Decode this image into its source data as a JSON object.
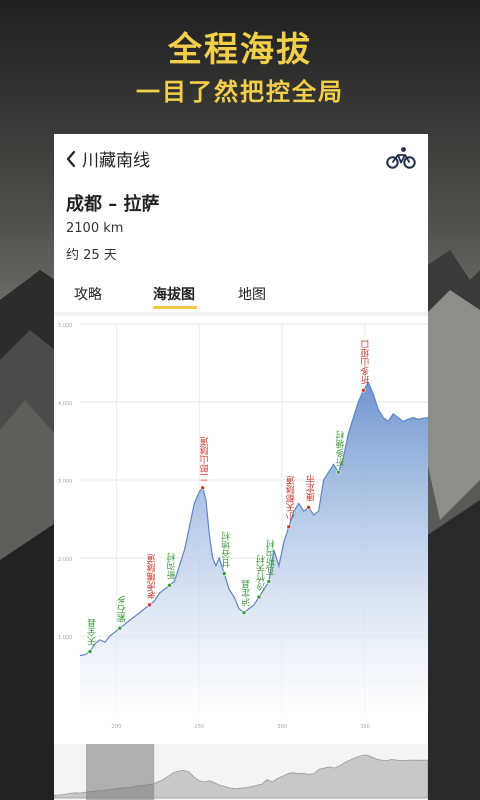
{
  "promo": {
    "title": "全程海拔",
    "subtitle": "一目了然把控全局"
  },
  "header": {
    "back_label": "川藏南线",
    "back_icon": "chevron-left-icon",
    "bike_icon": "bicycle-icon"
  },
  "route": {
    "name": "成都 – 拉萨",
    "distance": "2100 km",
    "duration": "约 25 天"
  },
  "tabs": [
    {
      "label": "攻略",
      "active": false
    },
    {
      "label": "海拔图",
      "active": true
    },
    {
      "label": "地图",
      "active": false
    }
  ],
  "colors": {
    "accent": "#f3c83e",
    "fill_top": "#6f96d1",
    "fill_bottom": "#ffffff",
    "line": "#5d85c4",
    "town_label": "#3c9a3c",
    "pass_label": "#c83a2e"
  },
  "chart_data": {
    "type": "area",
    "xlabel": "",
    "ylabel": "",
    "xlim": [
      178,
      388
    ],
    "ylim": [
      0,
      5000
    ],
    "y_ticks": [
      "1,000",
      "2,000",
      "3,000",
      "4,000",
      "5,000"
    ],
    "y_tick_values": [
      1000,
      2000,
      3000,
      4000,
      5000
    ],
    "x_ticks": [
      "200",
      "250",
      "300",
      "350"
    ],
    "x_tick_values": [
      200,
      250,
      300,
      350
    ],
    "grid": true,
    "series": [
      {
        "x": [
          178,
          181,
          184,
          187,
          190,
          193,
          196,
          199,
          202,
          205,
          208,
          211,
          214,
          217,
          220,
          223,
          226,
          229,
          232,
          235,
          238,
          241,
          244,
          247,
          250,
          252,
          254,
          256,
          258,
          260,
          262,
          265,
          268,
          271,
          274,
          277,
          280,
          283,
          286,
          289,
          292,
          295,
          298,
          301,
          304,
          307,
          310,
          313,
          316,
          319,
          322,
          325,
          328,
          331,
          334,
          337,
          340,
          343,
          346,
          349,
          352,
          355,
          358,
          361,
          364,
          367,
          370,
          373,
          376,
          379,
          382,
          385,
          388
        ],
        "y": [
          750,
          760,
          800,
          900,
          950,
          920,
          1000,
          1050,
          1100,
          1150,
          1200,
          1250,
          1300,
          1350,
          1400,
          1450,
          1550,
          1600,
          1650,
          1700,
          1900,
          2100,
          2400,
          2700,
          2850,
          2900,
          2750,
          2300,
          2000,
          1900,
          2000,
          1800,
          1600,
          1500,
          1350,
          1300,
          1350,
          1400,
          1500,
          1600,
          1700,
          2100,
          1900,
          2200,
          2400,
          2600,
          2700,
          2600,
          2650,
          2550,
          2600,
          3000,
          3100,
          3200,
          3100,
          3300,
          3600,
          3800,
          4000,
          4150,
          4250,
          4100,
          3900,
          3800,
          3750,
          3850,
          3800,
          3750,
          3780,
          3800,
          3780,
          3790,
          3800
        ]
      }
    ],
    "annotations": [
      {
        "label": "天全县",
        "x": 184,
        "y": 800,
        "kind": "town"
      },
      {
        "label": "紫石乡",
        "x": 202,
        "y": 1100,
        "kind": "town"
      },
      {
        "label": "老虎嘴隧道",
        "x": 220,
        "y": 1400,
        "kind": "pass"
      },
      {
        "label": "新沟村",
        "x": 232,
        "y": 1650,
        "kind": "town"
      },
      {
        "label": "二郎山隧道",
        "x": 252,
        "y": 2900,
        "kind": "pass"
      },
      {
        "label": "甘谷地村",
        "x": 265,
        "y": 1800,
        "kind": "town"
      },
      {
        "label": "泸定县",
        "x": 277,
        "y": 1300,
        "kind": "town"
      },
      {
        "label": "冷竹关村",
        "x": 286,
        "y": 1500,
        "kind": "town"
      },
      {
        "label": "瓦斯沟村",
        "x": 292,
        "y": 1700,
        "kind": "town"
      },
      {
        "label": "小天都隧道",
        "x": 304,
        "y": 2400,
        "kind": "pass"
      },
      {
        "label": "康定市",
        "x": 316,
        "y": 2650,
        "kind": "pass"
      },
      {
        "label": "折多塘村",
        "x": 334,
        "y": 3100,
        "kind": "town"
      },
      {
        "label": "折多山垭口",
        "x": 349,
        "y": 4150,
        "kind": "pass"
      }
    ],
    "window": [
      0,
      0.145
    ]
  }
}
